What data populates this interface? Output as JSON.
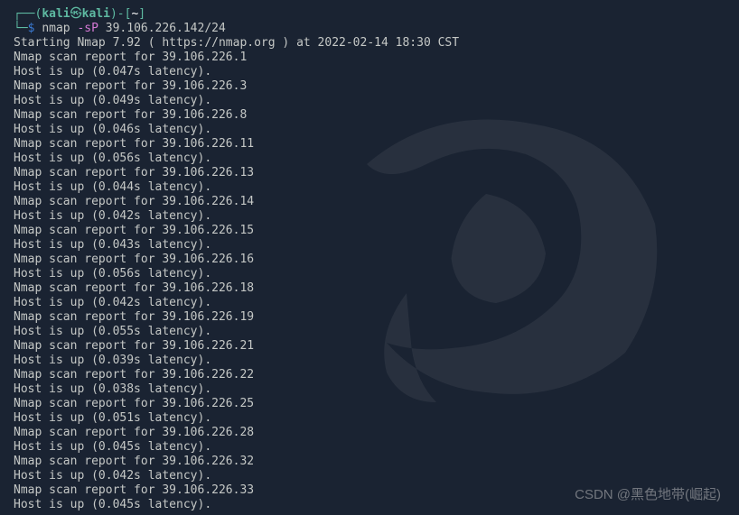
{
  "prompt": {
    "box_left": "┌──(",
    "user": "kali",
    "at": "㉿",
    "host": "kali",
    "box_right": ")-[",
    "path": "~",
    "box_close": "]",
    "line2_prefix": "└─",
    "dollar": "$"
  },
  "command": {
    "name": "nmap",
    "flag": "-sP",
    "arg": "39.106.226.142/24"
  },
  "output": {
    "start_line": "Starting Nmap 7.92 ( https://nmap.org ) at 2022-02-14 18:30 CST",
    "hosts": [
      {
        "ip": "39.106.226.1",
        "latency": "0.047s"
      },
      {
        "ip": "39.106.226.3",
        "latency": "0.049s"
      },
      {
        "ip": "39.106.226.8",
        "latency": "0.046s"
      },
      {
        "ip": "39.106.226.11",
        "latency": "0.056s"
      },
      {
        "ip": "39.106.226.13",
        "latency": "0.044s"
      },
      {
        "ip": "39.106.226.14",
        "latency": "0.042s"
      },
      {
        "ip": "39.106.226.15",
        "latency": "0.043s"
      },
      {
        "ip": "39.106.226.16",
        "latency": "0.056s"
      },
      {
        "ip": "39.106.226.18",
        "latency": "0.042s"
      },
      {
        "ip": "39.106.226.19",
        "latency": "0.055s"
      },
      {
        "ip": "39.106.226.21",
        "latency": "0.039s"
      },
      {
        "ip": "39.106.226.22",
        "latency": "0.038s"
      },
      {
        "ip": "39.106.226.25",
        "latency": "0.051s"
      },
      {
        "ip": "39.106.226.28",
        "latency": "0.045s"
      },
      {
        "ip": "39.106.226.32",
        "latency": "0.042s"
      },
      {
        "ip": "39.106.226.33",
        "latency": "0.045s"
      }
    ],
    "report_prefix": "Nmap scan report for ",
    "host_up_prefix": "Host is up (",
    "host_up_suffix": " latency)."
  },
  "watermark": "CSDN @黑色地带(崛起)"
}
